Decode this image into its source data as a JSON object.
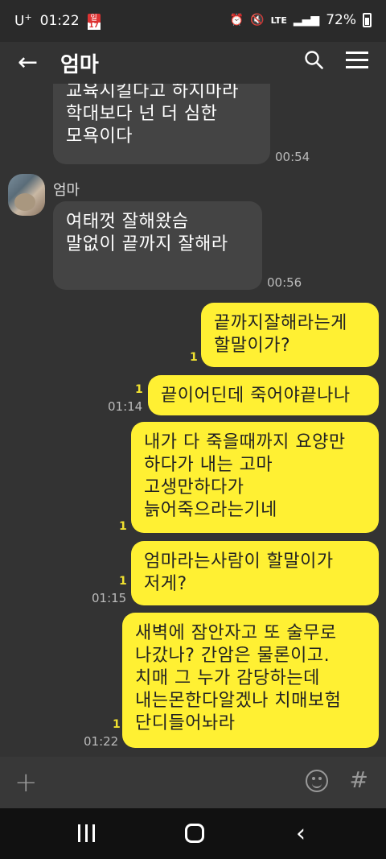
{
  "status_bar": {
    "carrier": "U",
    "carrier_sup": "+",
    "time": "01:22",
    "calendar_label": "일",
    "calendar_day": "17",
    "network": "LTE",
    "battery": "72%",
    "battery_level": 0.72
  },
  "header": {
    "title": "엄마"
  },
  "messages": [
    {
      "side": "left",
      "text": "교육시킬다고 하지마라\n학대보다 넌 더 심한\n모욕이다",
      "time": "00:54"
    },
    {
      "side": "left",
      "sender": "엄마",
      "text": "여태껏  잘해왔슴\n말없이  끝까지 잘해라",
      "time": "00:56"
    },
    {
      "side": "right",
      "text": "끝까지잘해라는게\n할말이가?",
      "unread": "1",
      "time": ""
    },
    {
      "side": "right",
      "text": "끝이어딘데 죽어야끝나나",
      "unread": "1",
      "time": "01:14"
    },
    {
      "side": "right",
      "text": "내가 다 죽을때까지 요양만\n하다가 내는 고마\n고생만하다가\n늙어죽으라는기네",
      "unread": "1",
      "time": ""
    },
    {
      "side": "right",
      "text": "엄마라는사람이  할말이가\n저게?",
      "unread": "1",
      "time": "01:15"
    },
    {
      "side": "right",
      "text": "새벽에 잠안자고 또 술무로\n나갔나? 간암은 물론이고.\n치매 그 누가 감당하는데\n내는몬한다알겠나 치매보험\n단디들어놔라",
      "unread": "1",
      "time": "01:22"
    }
  ],
  "input_bar": {
    "plus": "+",
    "hash": "#"
  },
  "colors": {
    "bg": "#333333",
    "my_bubble": "#fff033",
    "their_bubble": "#444444",
    "unread": "#f0e130"
  }
}
